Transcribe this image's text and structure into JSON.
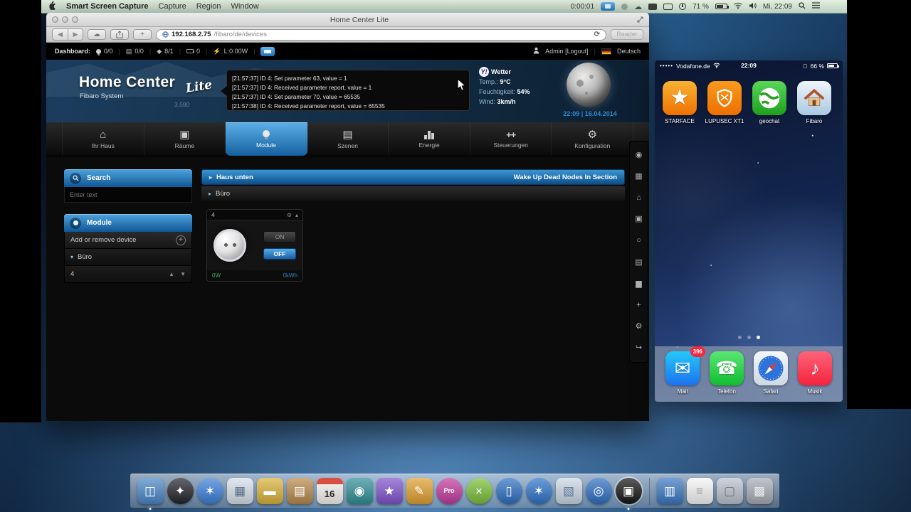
{
  "menubar": {
    "app_name": "Smart Screen Capture",
    "menus": [
      "Capture",
      "Region",
      "Window"
    ],
    "timer": "0:00:01",
    "battery_percent": "71 %",
    "clock": "Mi. 22:09"
  },
  "browser": {
    "window_title": "Home Center Lite",
    "url_host": "192.168.2.75",
    "url_path": "/fibaro/de/devices",
    "reader_label": "Reader"
  },
  "dashboard": {
    "label": "Dashboard:",
    "counters": [
      {
        "name": "lights",
        "value": "0/0"
      },
      {
        "name": "blinds",
        "value": "0/0"
      },
      {
        "name": "pins",
        "value": "8/1"
      },
      {
        "name": "battery",
        "value": "0"
      },
      {
        "name": "power",
        "value": "L:0.00W"
      }
    ],
    "user": "Admin [Logout]",
    "language": "Deutsch"
  },
  "header": {
    "logo_main": "Home Center",
    "logo_script": "Lite",
    "logo_sub": "Fibaro System",
    "version": "3.590",
    "log_lines": [
      "[21:57:37] ID 4: Set parameter 63, value = 1",
      "[21:57:37] ID 4: Received parameter report, value = 1",
      "[21:57:37] ID 4: Set parameter 70, value = 65535",
      "[21:57:38] ID 4: Received parameter report, value = 65535"
    ],
    "weather": {
      "provider": "Y!",
      "title": "Wetter",
      "temp_label": "Temp.:",
      "temp_value": "9°C",
      "humidity_label": "Feuchtigkeit:",
      "humidity_value": "54%",
      "wind_label": "Wind:",
      "wind_value": "3km/h",
      "datetime": "22:09 | 16.04.2014"
    }
  },
  "nav": {
    "tabs": [
      {
        "label": "Ihr Haus",
        "icon": "house",
        "glyph": "⌂",
        "active": false
      },
      {
        "label": "Räume",
        "icon": "rooms",
        "glyph": "▣",
        "active": false
      },
      {
        "label": "Module",
        "icon": "bulb",
        "glyph": "",
        "active": true
      },
      {
        "label": "Szenen",
        "icon": "scenes",
        "glyph": "▤",
        "active": false
      },
      {
        "label": "Energie",
        "icon": "chart",
        "glyph": "",
        "active": false
      },
      {
        "label": "Steuerungen",
        "icon": "people",
        "glyph": "++",
        "active": false
      },
      {
        "label": "Konfiguration",
        "icon": "gears",
        "glyph": "⚙",
        "active": false
      }
    ]
  },
  "sidebar": {
    "search_title": "Search",
    "search_placeholder": "Enter text",
    "module_title": "Module",
    "add_remove_label": "Add or remove device",
    "room_filter": "Büro",
    "device_filter": "4"
  },
  "main": {
    "section_title": "Haus unten",
    "section_action": "Wake Up Dead Nodes In Section",
    "room_title": "Büro",
    "device": {
      "id": "4",
      "on_label": "ON",
      "off_label": "OFF",
      "power": "0W",
      "energy": "0kWh"
    }
  },
  "side_strip": {
    "icons": [
      {
        "name": "user-icon",
        "glyph": "◉"
      },
      {
        "name": "dashboard-icon",
        "glyph": "▦"
      },
      {
        "name": "house-icon",
        "glyph": "⌂"
      },
      {
        "name": "rooms-icon",
        "glyph": "▣"
      },
      {
        "name": "modules-icon",
        "glyph": "○"
      },
      {
        "name": "scenes-icon",
        "glyph": "▤"
      },
      {
        "name": "energy-icon",
        "glyph": "▆"
      },
      {
        "name": "devices-icon",
        "glyph": "+"
      },
      {
        "name": "settings-icon",
        "glyph": "⚙"
      },
      {
        "name": "logout-icon",
        "glyph": "↪"
      }
    ]
  },
  "iphone": {
    "signal_dots": "•••••",
    "carrier": "Vodafone.de",
    "time": "22:09",
    "battery_percent": "66 %",
    "apps": [
      {
        "label": "STARFACE",
        "type": "star",
        "bg1": "#f9b234",
        "bg2": "#ef7100"
      },
      {
        "label": "LUPUSEC XT1",
        "type": "shield",
        "bg1": "#f79b1d",
        "bg2": "#ee6f00"
      },
      {
        "label": "geochat",
        "type": "globe",
        "bg1": "#59d659",
        "bg2": "#1da11d"
      },
      {
        "label": "Fibaro",
        "type": "house",
        "bg1": "#eef5fb",
        "bg2": "#a9c9e2"
      }
    ],
    "dock": [
      {
        "label": "Mail",
        "type": "mail",
        "badge": "396",
        "bg1": "#24c9fb",
        "bg2": "#1b72ef"
      },
      {
        "label": "Telefon",
        "type": "phone",
        "bg1": "#5ae675",
        "bg2": "#10bd2f"
      },
      {
        "label": "Safari",
        "type": "safari",
        "bg1": "#f4f8fb",
        "bg2": "#cdd8e1"
      },
      {
        "label": "Musik",
        "type": "music",
        "bg1": "#fd6479",
        "bg2": "#f5233d"
      }
    ]
  },
  "macdock": {
    "items": [
      {
        "name": "finder",
        "glyph": "◫",
        "bg": "#4a86c7",
        "running": true
      },
      {
        "name": "launchpad",
        "glyph": "✦",
        "bg": "#23232b",
        "shape": "circle"
      },
      {
        "name": "safari",
        "glyph": "✶",
        "bg": "#3b7fd9",
        "shape": "circle"
      },
      {
        "name": "preview",
        "glyph": "▦",
        "bg": "#d8e0ea",
        "fg": "#56708a"
      },
      {
        "name": "delivery",
        "glyph": "▬",
        "bg": "#d9b23a"
      },
      {
        "name": "contacts",
        "glyph": "▤",
        "bg": "#b9894a"
      },
      {
        "name": "calendar",
        "glyph": "16",
        "bg": "#f6f4f0",
        "fg": "#222222",
        "cls": "cal"
      },
      {
        "name": "photo-booth",
        "glyph": "◉",
        "bg": "#2f8f96"
      },
      {
        "name": "star-app",
        "glyph": "★",
        "bg": "#8052cc"
      },
      {
        "name": "pen-app",
        "glyph": "✎",
        "bg": "#e0a030"
      },
      {
        "name": "pro-app",
        "glyph": "Pro",
        "bg": "#c23a9e",
        "shape": "circle",
        "cls": "small"
      },
      {
        "name": "x-app",
        "glyph": "×",
        "bg": "#7bbf3a",
        "shape": "circle"
      },
      {
        "name": "media-app",
        "glyph": "▯",
        "bg": "#2e6fc2",
        "shape": "circle"
      },
      {
        "name": "appstore-app",
        "glyph": "✶",
        "bg": "#2e74c9",
        "shape": "circle"
      },
      {
        "name": "map-app",
        "glyph": "▧",
        "bg": "#ccd8e4",
        "fg": "#5a7a9a"
      },
      {
        "name": "globe-app",
        "glyph": "◎",
        "bg": "#2e6fc2",
        "shape": "circle"
      },
      {
        "name": "capture-app",
        "glyph": "▣",
        "bg": "#151515",
        "shape": "circle",
        "active": true,
        "running": true
      },
      {
        "sep": true
      },
      {
        "name": "archive-box",
        "glyph": "▥",
        "bg": "#3a78c2"
      },
      {
        "name": "text-document",
        "glyph": "≡",
        "bg": "#f6f6f6",
        "fg": "#999999"
      },
      {
        "name": "file-stack",
        "glyph": "▢",
        "bg": "#b9c2cc",
        "fg": "#667788"
      },
      {
        "name": "trash",
        "glyph": "▩",
        "bg": "#a7adb4",
        "fg": "#e8ebef"
      }
    ]
  }
}
